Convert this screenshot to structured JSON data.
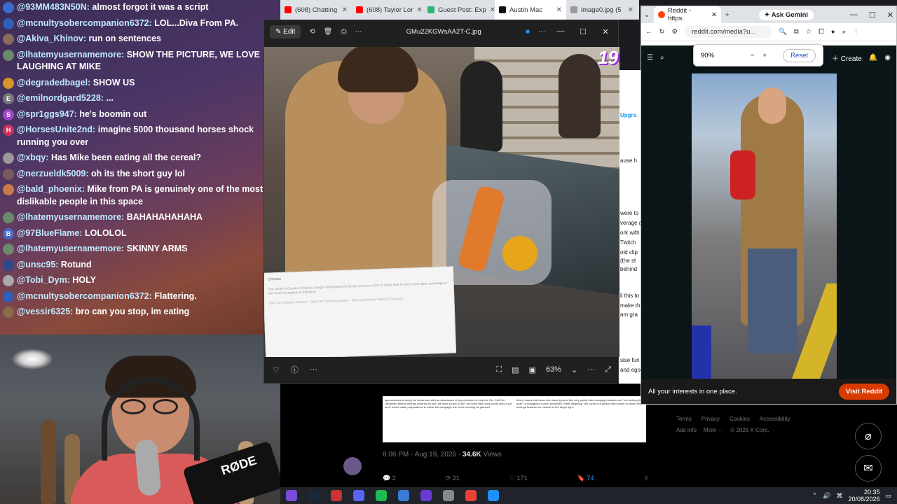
{
  "chat": {
    "messages": [
      {
        "user": "@93MM483N50N:",
        "text": "almost forgot it was a script",
        "badge_color": "#3a6bd1",
        "badge_char": ""
      },
      {
        "user": "@mcnultysobercompanion6372:",
        "text": "LOL...Diva From PA.",
        "badge_color": "#2f5fb8",
        "badge_char": ""
      },
      {
        "user": "@Akiva_Khinov:",
        "text": "run on sentences",
        "badge_color": "#8b6b5a",
        "badge_char": ""
      },
      {
        "user": "@lhatemyusernamemore:",
        "text": "SHOW THE PICTURE, WE LOVE LAUGHING AT MIKE",
        "badge_color": "#6a8a6a",
        "badge_char": ""
      },
      {
        "user": "@degradedbagel:",
        "text": "SHOW US",
        "badge_color": "#d6942a",
        "badge_char": ""
      },
      {
        "user": "@emilnordgard5228:",
        "text": "...",
        "badge_color": "#777777",
        "badge_char": "E"
      },
      {
        "user": "@spr1ggs947:",
        "text": "he's boomin out",
        "badge_color": "#a046c8",
        "badge_char": "S"
      },
      {
        "user": "@HorsesUnite2nd:",
        "text": "imagine 5000 thousand horses shock running you over",
        "badge_color": "#c8325a",
        "badge_char": "H"
      },
      {
        "user": "@xbqy:",
        "text": "Has Mike been eating all the cereal?",
        "badge_color": "#999999",
        "badge_char": ""
      },
      {
        "user": "@nerzueldk5009:",
        "text": "oh its the short guy lol",
        "badge_color": "#7a5a5a",
        "badge_char": ""
      },
      {
        "user": "@bald_phoenix:",
        "text": "Mike from PA is genuinely one of the most dislikable people in this space",
        "badge_color": "#c87a4a",
        "badge_char": ""
      },
      {
        "user": "@lhatemyusernamemore:",
        "text": "BAHAHAHAHAHA",
        "badge_color": "#6a8a6a",
        "badge_char": ""
      },
      {
        "user": "@97BlueFlame:",
        "text": "LOLOLOL",
        "badge_color": "#4a6ac8",
        "badge_char": "B"
      },
      {
        "user": "@lhatemyusernamemore:",
        "text": "SKINNY ARMS",
        "badge_color": "#6a8a6a",
        "badge_char": ""
      },
      {
        "user": "@unsc95:",
        "text": "Rotund",
        "badge_color": "#2a4a8a",
        "badge_char": ""
      },
      {
        "user": "@Tobi_Dym:",
        "text": "HOLY",
        "badge_color": "#aaaaaa",
        "badge_char": ""
      },
      {
        "user": "@mcnultysobercompanion6372:",
        "text": "Flattering.",
        "badge_color": "#2f5fb8",
        "badge_char": ""
      },
      {
        "user": "@vessir6325:",
        "text": "bro can you stop, im eating",
        "badge_color": "#8a6a4a",
        "badge_char": ""
      }
    ]
  },
  "webcam": {
    "mic_brand": "RØDE"
  },
  "browser_tabs": [
    {
      "label": "(608) Chatting",
      "color": "#ff0000",
      "active": false
    },
    {
      "label": "(608) Taylor Lor",
      "color": "#ff0000",
      "active": false
    },
    {
      "label": "Guest Post: Exp",
      "color": "#2bb673",
      "active": false
    },
    {
      "label": "Austin Mac",
      "color": "#111111",
      "active": true
    },
    {
      "label": "image0.jpg (5",
      "color": "#999999",
      "active": false
    }
  ],
  "viewer": {
    "edit_label": "Edit",
    "filename": "GMu22KGWsAA2T-C.jpg",
    "zoom": "63%",
    "overlay_number": "19",
    "doc": {
      "title": "Cheetos",
      "body": "The owner of Cheetos, PepsiCo, bought SodaStream for $3.2bn and owns 50% of Sabra both of which have taken advantage of the Israeli occupation of Palestine",
      "actions": "Don't buy Cheetos products · Don't sell Cheetos products · Don't work for the PepsiCo Company"
    }
  },
  "xpost": {
    "thumb_text_1": "appearances at along the livestream with an abundance of my principles to help the Fire Cult Del. \"whatever Mike's feelings towards me are, we have a race to win\" and now Mike they would work it out and I would make preparations to follow the campaign line in the morning as planned.",
    "thumb_text_2": "this in hopes that those who have ignored this very public hate campaign towards me \"not rocking the boat\" or engaging in some perceived \"leftist infighting\" will come of a person who chose to center his feelings towards me instead of the larger fight.",
    "time_label": "8:06 PM · Aug 19, 2026 · ",
    "views_count": "34.6K",
    "views_label": "Views",
    "replies": "2",
    "reposts": "21",
    "likes": "171",
    "bookmarks": "74"
  },
  "xmid_fragments": [
    "Upgra",
    "ause h",
    "were to",
    "verage a",
    "ork with",
    "Twitch",
    "old clip",
    "(the st",
    "behind",
    "il this to",
    "make th",
    "am gra",
    "sise fun",
    "and ego"
  ],
  "reddit": {
    "tab_label": "Reddit - https:",
    "gemini_label": "Ask Gemini",
    "address": "reddit.com/media?u...",
    "zoom_value": "90%",
    "reset_label": "Reset",
    "create_label": "Create",
    "bottom_text": "All your interests in one place.",
    "visit_label": "Visit Reddit"
  },
  "xfooter": {
    "links": [
      "Terms",
      "Privacy",
      "Cookies",
      "Accessibility"
    ],
    "links2": [
      "Ads info",
      "More ···",
      "© 2026 X Corp."
    ]
  },
  "taskbar": {
    "time": "20:35",
    "date": "20/08/2026",
    "icons": [
      {
        "name": "arc-icon",
        "color": "#7b4bdc"
      },
      {
        "name": "steam-icon",
        "color": "#1b2838"
      },
      {
        "name": "davinci-icon",
        "color": "#c33"
      },
      {
        "name": "discord-icon",
        "color": "#5865f2"
      },
      {
        "name": "spotify-icon",
        "color": "#1db954"
      },
      {
        "name": "app-icon",
        "color": "#3a7bd5"
      },
      {
        "name": "obs-icon",
        "color": "#6a3ad5"
      },
      {
        "name": "app2-icon",
        "color": "#888"
      },
      {
        "name": "chrome-icon",
        "color": "#e94235"
      },
      {
        "name": "paint-icon",
        "color": "#1e90ff"
      }
    ]
  }
}
